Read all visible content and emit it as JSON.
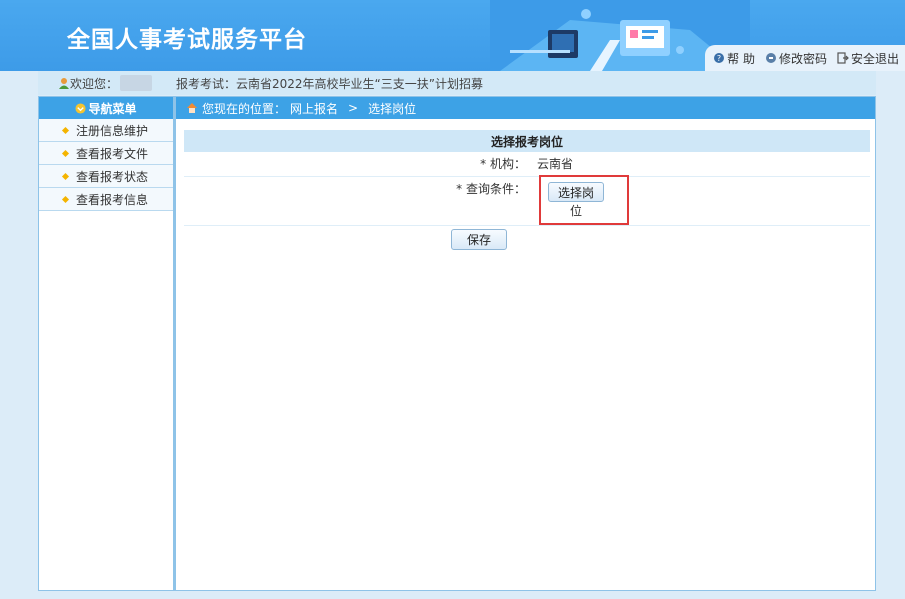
{
  "header": {
    "site_title": "全国人事考试服务平台",
    "links": [
      {
        "icon": "help-icon",
        "label": "帮 助"
      },
      {
        "icon": "key-icon",
        "label": "修改密码"
      },
      {
        "icon": "exit-icon",
        "label": "安全退出"
      }
    ]
  },
  "welcome": {
    "label": "欢迎您：",
    "exam": "报考考试：云南省2022年高校毕业生“三支一扶”计划招募"
  },
  "sidebar": {
    "title": "导航菜单",
    "items": [
      {
        "label": "注册信息维护"
      },
      {
        "label": "查看报考文件"
      },
      {
        "label": "查看报考状态"
      },
      {
        "label": "查看报考信息"
      }
    ]
  },
  "breadcrumb": {
    "prefix": "您现在的位置：",
    "path": [
      "网上报名",
      "选择岗位"
    ],
    "separator": ">"
  },
  "form": {
    "title": "选择报考岗位",
    "org_label": "* 机构：",
    "org_value": "云南省",
    "query_label": "* 查询条件：",
    "pick_button_line1": "选择岗",
    "pick_button_line2": "位",
    "save_label": "保存"
  },
  "colors": {
    "header_bg": "#4aa8ef",
    "nav_bar": "#3da2e6",
    "highlight_box": "#e03a3a"
  }
}
